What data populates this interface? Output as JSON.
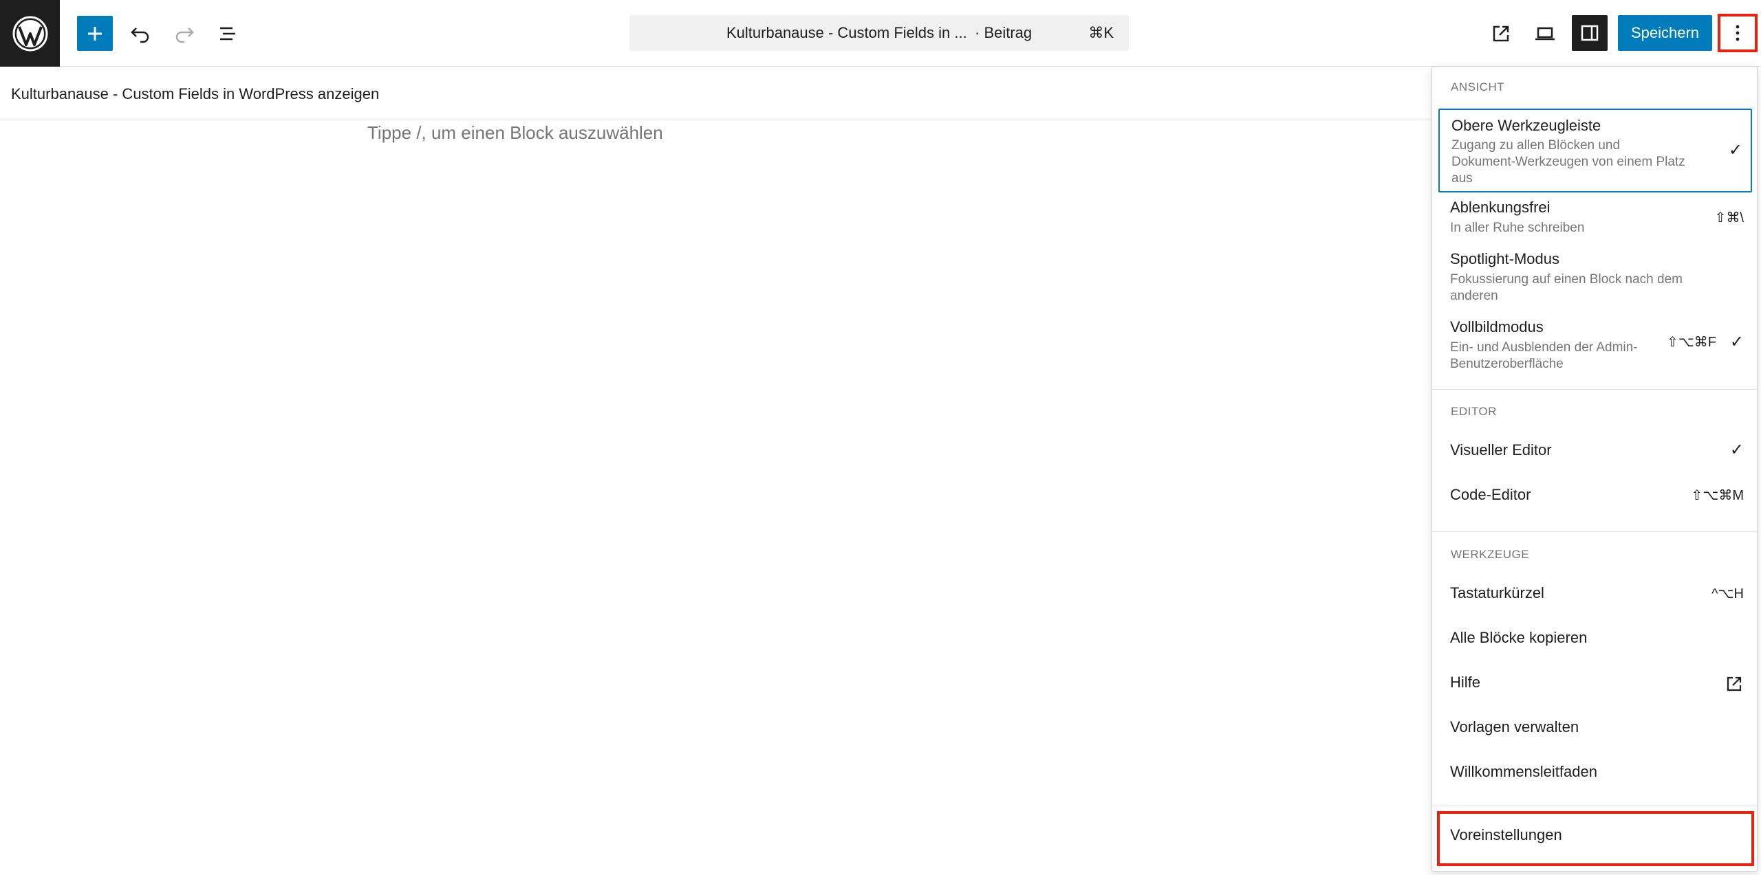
{
  "toolbar": {
    "command_title": "Kulturbanause - Custom Fields in ...",
    "command_type": "· Beitrag",
    "command_shortcut": "⌘K",
    "save_label": "Speichern"
  },
  "document": {
    "title": "Kulturbanause - Custom Fields in WordPress anzeigen",
    "placeholder": "Tippe /, um einen Block auszuwählen"
  },
  "menu": {
    "view_group": "ANSICHT",
    "view_items": [
      {
        "label": "Obere Werkzeugleiste",
        "description": "Zugang zu allen Blöcken und Dokument-Werkzeugen von einem Platz aus",
        "shortcut": "",
        "checked": "✓"
      },
      {
        "label": "Ablenkungsfrei",
        "description": "In aller Ruhe schreiben",
        "shortcut": "⇧⌘\\",
        "checked": ""
      },
      {
        "label": "Spotlight-Modus",
        "description": "Fokussierung auf einen Block nach dem anderen",
        "shortcut": "",
        "checked": ""
      },
      {
        "label": "Vollbildmodus",
        "description": "Ein- und Ausblenden der Admin-Benutzeroberfläche",
        "shortcut": "⇧⌥⌘F",
        "checked": "✓"
      }
    ],
    "editor_group": "EDITOR",
    "editor_items": [
      {
        "label": "Visueller Editor",
        "shortcut": "",
        "checked": "✓"
      },
      {
        "label": "Code-Editor",
        "shortcut": "⇧⌥⌘M",
        "checked": ""
      }
    ],
    "tools_group": "WERKZEUGE",
    "tools_items": [
      {
        "label": "Tastaturkürzel",
        "shortcut": "^⌥H"
      },
      {
        "label": "Alle Blöcke kopieren",
        "shortcut": ""
      },
      {
        "label": "Hilfe",
        "shortcut": ""
      },
      {
        "label": "Vorlagen verwalten",
        "shortcut": ""
      },
      {
        "label": "Willkommensleitfaden",
        "shortcut": ""
      }
    ],
    "preferences_label": "Voreinstellungen"
  },
  "colors": {
    "accent": "#007cba",
    "dark": "#1e1e1e",
    "highlight": "#e8220f"
  }
}
